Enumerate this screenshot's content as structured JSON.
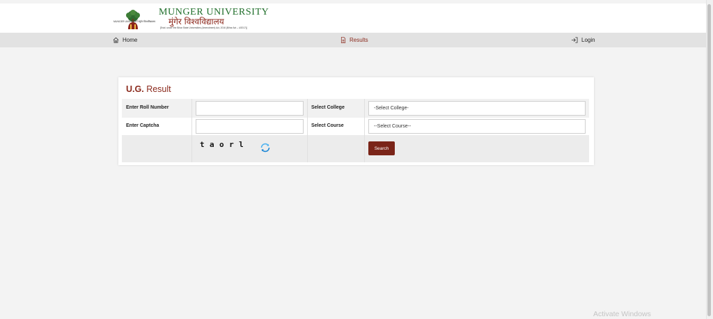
{
  "header": {
    "university_name_en": "MUNGER UNIVERSITY",
    "university_name_hi": "मुंगेर विश्वविद्यालय",
    "established_line": "[Estd. under the Bihar State Universities (Amendment) Act, 2016 (Bihar Act – 4/2017)]",
    "logo_left_text": "MUNGER UNIVERSITY",
    "logo_right_text": "मुंगेर विश्वविद्यालय",
    "brand_green": "#1f6e2a",
    "brand_maroon": "#8b2418"
  },
  "nav": {
    "home_label": "Home",
    "home_icon": "home-icon",
    "results_label": "Results",
    "results_icon": "document-icon",
    "login_label": "Login",
    "login_icon": "login-arrow-icon"
  },
  "result_form": {
    "title_bold": "U.G.",
    "title_rest": "Result",
    "roll_label": "Enter Roll Number",
    "roll_value": "",
    "captcha_label": "Enter Captcha",
    "captcha_value": "",
    "college_label": "Select College",
    "college_selected": "-Select College-",
    "course_label": "Select Course",
    "course_selected": "--Select Course--",
    "captcha_image_text": "taorl",
    "refresh_icon": "refresh-icon",
    "search_label": "Search",
    "accent": "#7a2418"
  },
  "watermark": {
    "text": "Activate Windows"
  }
}
